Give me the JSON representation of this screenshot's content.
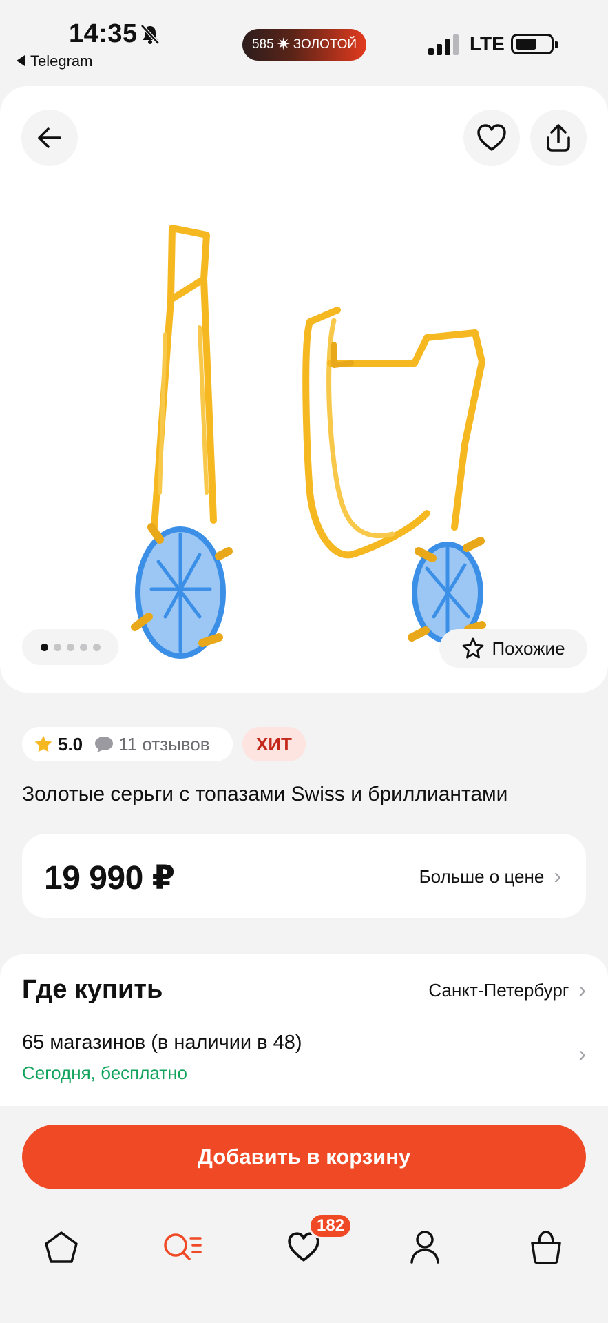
{
  "status_bar": {
    "time": "14:35",
    "back_app": "Telegram",
    "brand_left": "585",
    "brand_right": "ЗОЛОТОЙ",
    "network": "LTE"
  },
  "product": {
    "rating": "5.0",
    "reviews": "11 отзывов",
    "badge": "ХИТ",
    "title": "Золотые серьги с топазами Swiss и бриллиантами",
    "similar_label": "Похожие",
    "gallery_count": 5,
    "gallery_active": 0
  },
  "price": {
    "value": "19 990 ₽",
    "more_label": "Больше о цене"
  },
  "buy": {
    "title": "Где купить",
    "city": "Санкт-Петербург",
    "stores": "65 магазинов (в наличии в 48)",
    "delivery": "Сегодня, бесплатно"
  },
  "cart_button": "Добавить в корзину",
  "nav": {
    "favorites_count": "182",
    "active": "catalog"
  },
  "colors": {
    "accent": "#ef4a25",
    "delivery_green": "#12a35c",
    "gold": "#f5b821",
    "topaz_blue": "#3b8fe6"
  }
}
